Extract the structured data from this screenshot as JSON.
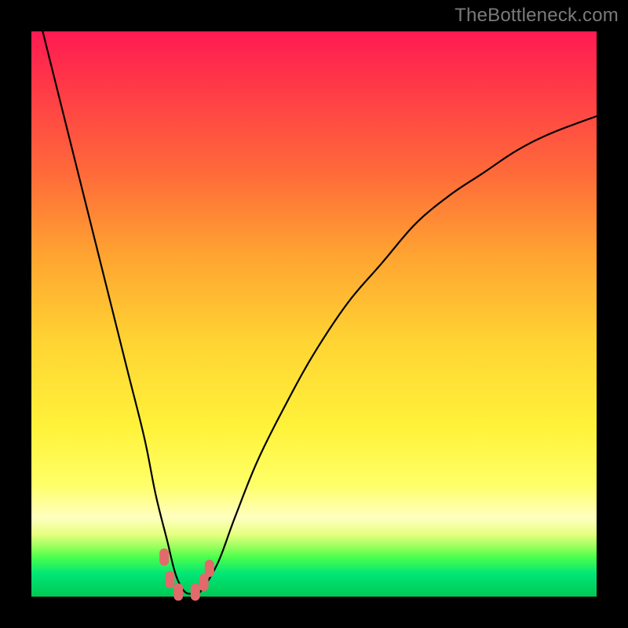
{
  "watermark": "TheBottleneck.com",
  "chart_data": {
    "type": "line",
    "title": "",
    "xlabel": "",
    "ylabel": "",
    "xlim": [
      0,
      100
    ],
    "ylim": [
      0,
      100
    ],
    "grid": false,
    "legend": false,
    "series": [
      {
        "name": "bottleneck-curve",
        "x": [
          2,
          5,
          8,
          11,
          14,
          17,
          20,
          22,
          24,
          25.5,
          27,
          28.5,
          30,
          33,
          36,
          40,
          45,
          50,
          56,
          62,
          68,
          74,
          80,
          86,
          92,
          100
        ],
        "y": [
          100,
          88,
          76,
          64,
          52,
          40,
          28,
          18,
          10,
          4,
          1,
          0.5,
          1,
          6,
          14,
          24,
          34,
          43,
          52,
          59,
          66,
          71,
          75,
          79,
          82,
          85
        ]
      }
    ],
    "markers": [
      {
        "x": 23.5,
        "y": 7
      },
      {
        "x": 24.5,
        "y": 3
      },
      {
        "x": 26.0,
        "y": 0.8
      },
      {
        "x": 29.0,
        "y": 0.8
      },
      {
        "x": 30.5,
        "y": 2.5
      },
      {
        "x": 31.5,
        "y": 5
      }
    ],
    "gradient_stops": [
      {
        "pos": 0,
        "color": "#ff1a52"
      },
      {
        "pos": 25,
        "color": "#ff6a3a"
      },
      {
        "pos": 55,
        "color": "#ffd433"
      },
      {
        "pos": 80,
        "color": "#ffff66"
      },
      {
        "pos": 93,
        "color": "#4dff4d"
      },
      {
        "pos": 100,
        "color": "#00c853"
      }
    ]
  }
}
